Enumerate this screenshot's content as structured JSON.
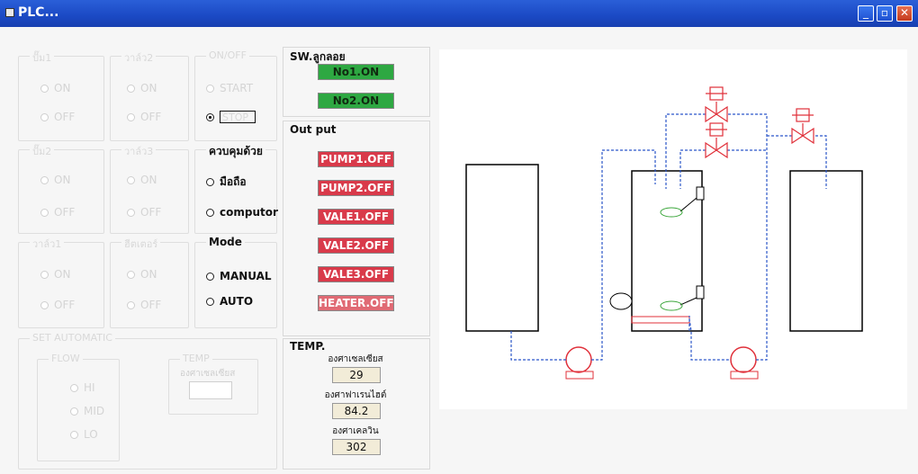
{
  "window": {
    "title": "PLC..."
  },
  "titlebar_buttons": {
    "minimize": "_",
    "maximize": "▫",
    "close": "✕"
  },
  "groups": [
    {
      "title": "ปั๊ม1",
      "options": [
        "ON",
        "OFF"
      ]
    },
    {
      "title": "วาล์ว2",
      "options": [
        "ON",
        "OFF"
      ]
    },
    {
      "title": "ปั๊ม2",
      "options": [
        "ON",
        "OFF"
      ]
    },
    {
      "title": "วาล์ว3",
      "options": [
        "ON",
        "OFF"
      ]
    },
    {
      "title": "วาล์ว1",
      "options": [
        "ON",
        "OFF"
      ]
    },
    {
      "title": "ฮีตเตอร์",
      "options": [
        "ON",
        "OFF"
      ]
    }
  ],
  "onoff": {
    "title": "ON/OFF",
    "start": "START",
    "stop": "STOP"
  },
  "control": {
    "title": "ควบคุมด้วย",
    "option1": "มือถือ",
    "option2": "computor"
  },
  "mode": {
    "title": "Mode",
    "manual": "MANUAL",
    "auto": "AUTO"
  },
  "set_auto": {
    "title": "SET AUTOMATIC",
    "flow": {
      "title": "FLOW",
      "options": [
        "HI",
        "MID",
        "LO"
      ]
    },
    "temp": {
      "title": "TEMP",
      "label": "องศาเซลเซียส"
    }
  },
  "switch_section": {
    "title": "SW.ลูกลอย",
    "items": [
      {
        "label": "No1.ON",
        "state": "on"
      },
      {
        "label": "No2.ON",
        "state": "on"
      }
    ]
  },
  "output_section": {
    "title": "Out put",
    "items": [
      {
        "label": "PUMP1.OFF"
      },
      {
        "label": "PUMP2.OFF"
      },
      {
        "label": "VALE1.OFF"
      },
      {
        "label": "VALE2.OFF"
      },
      {
        "label": "VALE3.OFF"
      },
      {
        "label": "HEATER.OFF"
      }
    ]
  },
  "temp_section": {
    "title": "TEMP.",
    "readings": [
      {
        "label": "องศาเซลเซียส",
        "value": "29"
      },
      {
        "label": "องศาฟาเรนไฮต์",
        "value": "84.2"
      },
      {
        "label": "องศาเคลวิน",
        "value": "302"
      }
    ]
  },
  "colors": {
    "status_on": "#2ea842",
    "status_off": "#d93a4a",
    "pipe": "#2b56c9",
    "valve": "#e0303a",
    "sensor": "#3aa63a"
  }
}
